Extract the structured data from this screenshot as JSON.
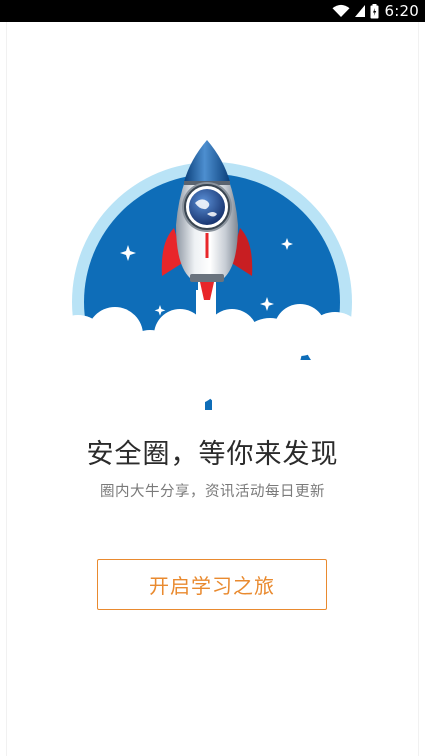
{
  "status_bar": {
    "time": "6:20",
    "icons": [
      "wifi-icon",
      "signal-icon",
      "battery-icon"
    ],
    "background": "#000000"
  },
  "hero": {
    "illustration": "rocket-launch-illustration",
    "colors": {
      "outer_ring": "#b9e3f6",
      "circle": "#0e6db8",
      "rocket_fin": "#e8262a",
      "clouds": "#ffffff"
    }
  },
  "headline": "安全圈，等你来发现",
  "subheadline": "圈内大牛分享，资讯活动每日更新",
  "start_button": {
    "label": "开启学习之旅",
    "color": "#e98a2f"
  }
}
